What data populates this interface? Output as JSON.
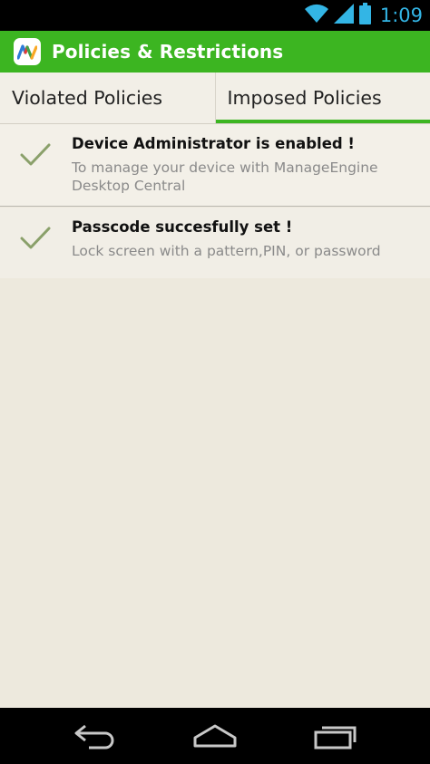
{
  "status_bar": {
    "time": "1:09",
    "icons": [
      "wifi-icon",
      "signal-icon",
      "battery-icon"
    ]
  },
  "action_bar": {
    "title": "Policies & Restrictions",
    "app_icon": "manageengine-logo-icon",
    "color": "#3cb521"
  },
  "tabs": [
    {
      "label": "Violated Policies",
      "selected": false
    },
    {
      "label": "Imposed Policies",
      "selected": true
    }
  ],
  "policies": [
    {
      "title": "Device Administrator is enabled !",
      "description": "To manage your device with ManageEngine Desktop Central",
      "icon": "check-icon"
    },
    {
      "title": "Passcode succesfully set !",
      "description": "Lock screen with a pattern,PIN, or password",
      "icon": "check-icon"
    }
  ],
  "nav_bar": {
    "buttons": [
      "back-icon",
      "home-icon",
      "recents-icon"
    ]
  },
  "colors": {
    "accent": "#3cb521",
    "status": "#33b5e5",
    "check": "#8aa06a",
    "background": "#ede9dd"
  }
}
